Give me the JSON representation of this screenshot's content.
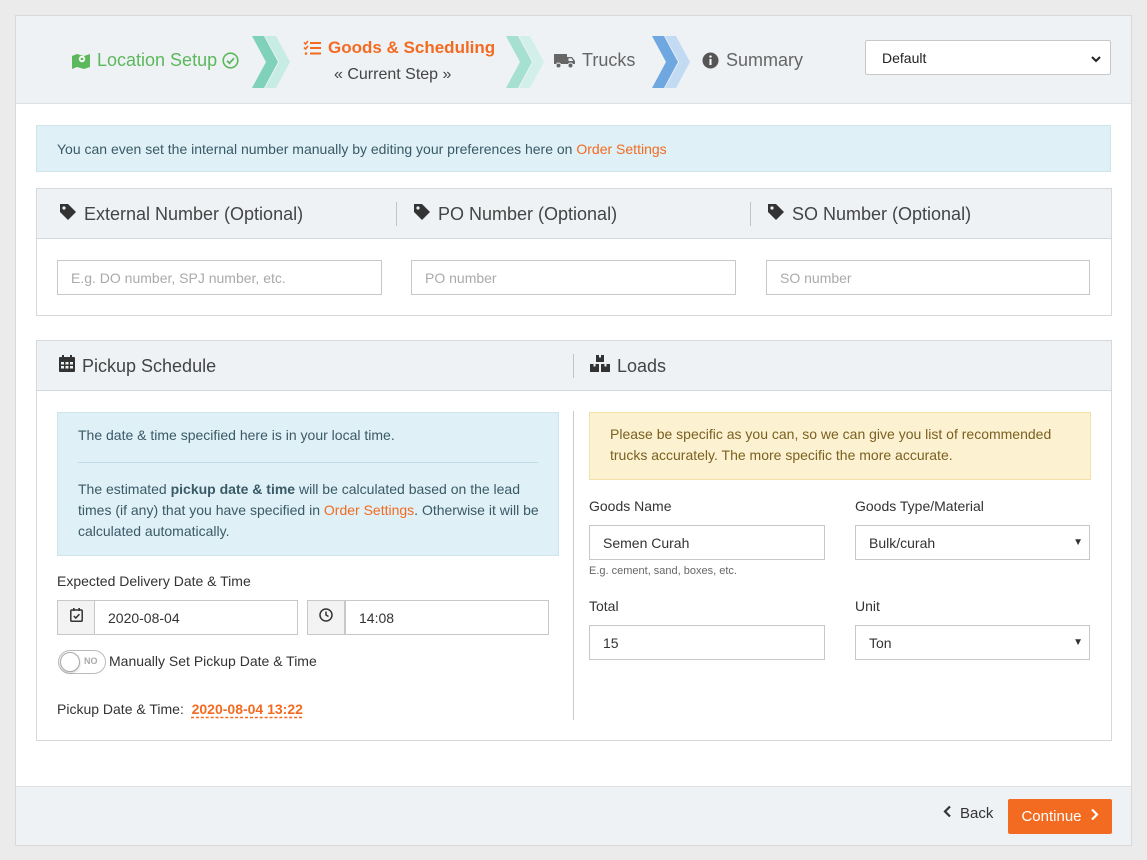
{
  "stepper": {
    "steps": [
      {
        "label": "Location Setup",
        "state": "done"
      },
      {
        "label": "Goods & Scheduling",
        "state": "current",
        "sublabel": "« Current Step »"
      },
      {
        "label": "Trucks",
        "state": "pending"
      },
      {
        "label": "Summary",
        "state": "pending"
      }
    ],
    "preset_select": {
      "value": "Default"
    }
  },
  "info_alert": {
    "text": "You can even set the internal number manually by editing your preferences here on ",
    "link": "Order Settings"
  },
  "numbers_panel": {
    "external": {
      "label": "External Number (Optional)",
      "placeholder": "E.g. DO number, SPJ number, etc."
    },
    "po": {
      "label": "PO Number (Optional)",
      "placeholder": "PO number"
    },
    "so": {
      "label": "SO Number (Optional)",
      "placeholder": "SO number"
    }
  },
  "schedule_panel": {
    "pickup_header": "Pickup Schedule",
    "loads_header": "Loads",
    "local_time_note": "The date & time specified here is in your local time.",
    "estimate_note": {
      "pre": "The estimated ",
      "bold": "pickup date & time",
      "mid1": " will be calculated based on the lead",
      "mid2": "times (if any) that you have specified in ",
      "link": "Order Settings",
      "post": ". Otherwise it will be",
      "last": "calculated automatically."
    },
    "delivery_label": "Expected Delivery Date & Time",
    "delivery_date": "2020-08-04",
    "delivery_time": "14:08",
    "manual_toggle": {
      "label": "Manually Set Pickup Date & Time",
      "state": "NO"
    },
    "pickup_label": "Pickup Date & Time:",
    "pickup_value": "2020-08-04 13:22"
  },
  "loads": {
    "warning_line1": "Please be specific as you can, so we can give you list of recommended",
    "warning_line2": "trucks accurately. The more specific the more accurate.",
    "goods_name_label": "Goods Name",
    "goods_name_value": "Semen Curah",
    "goods_name_hint": "E.g. cement, sand, boxes, etc.",
    "goods_type_label": "Goods Type/Material",
    "goods_type_value": "Bulk/curah",
    "total_label": "Total",
    "total_value": "15",
    "unit_label": "Unit",
    "unit_value": "Ton"
  },
  "footer": {
    "back": "Back",
    "continue": "Continue"
  },
  "colors": {
    "accent": "#f26b21",
    "success": "#5cb85c",
    "info_bg": "#dff0f7",
    "warning_bg": "#fcf1d0",
    "step_chevron_done": "#aee3d3",
    "step_chevron_pending": "#a9cdef"
  }
}
